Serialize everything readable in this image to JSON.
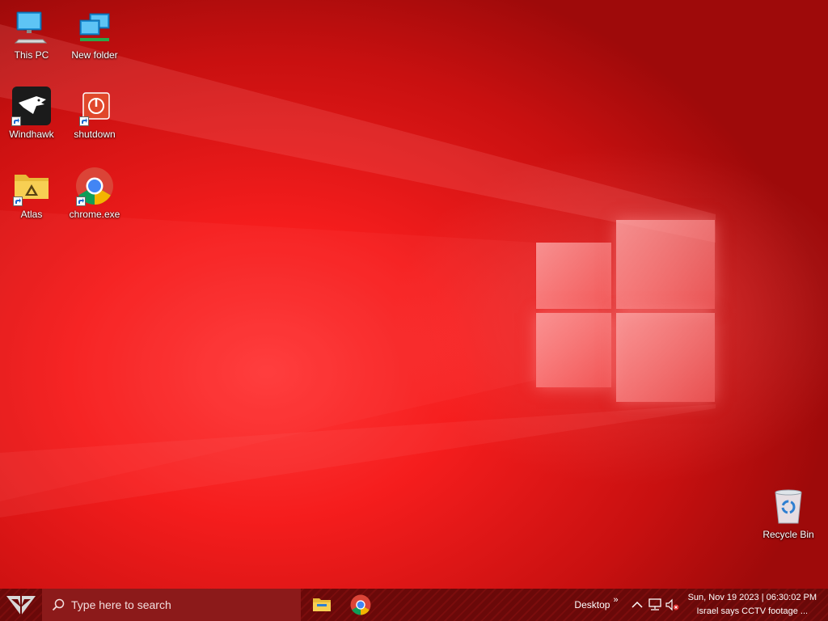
{
  "desktop": {
    "icons": [
      {
        "label": "This PC",
        "icon": "monitor-icon",
        "shortcut": false
      },
      {
        "label": "New folder",
        "icon": "network-computers-icon",
        "shortcut": false
      },
      {
        "label": "Windhawk",
        "icon": "eagle-icon",
        "shortcut": true
      },
      {
        "label": "shutdown",
        "icon": "power-icon",
        "shortcut": true
      },
      {
        "label": "Atlas",
        "icon": "folder-icon",
        "shortcut": true
      },
      {
        "label": "chrome.exe",
        "icon": "chrome-icon",
        "shortcut": true
      },
      {
        "label": "Recycle Bin",
        "icon": "recycle-bin-icon",
        "shortcut": false
      }
    ],
    "wallpaper_color": "#f51d1d"
  },
  "taskbar": {
    "search_placeholder": "Type here to search",
    "pinned": [
      {
        "name": "File Explorer",
        "icon": "file-explorer-icon"
      },
      {
        "name": "Google Chrome",
        "icon": "chrome-icon"
      }
    ],
    "desktop_label": "Desktop",
    "overflow_chevron": "»",
    "tray": {
      "chevron": "^",
      "network_icon": "network-icon",
      "volume_icon": "volume-muted-icon"
    },
    "clock_line1": "Sun, Nov 19 2023 | 06:30:02 PM",
    "clock_line2": "Israel says CCTV footage ...",
    "color": "#6a0909"
  }
}
